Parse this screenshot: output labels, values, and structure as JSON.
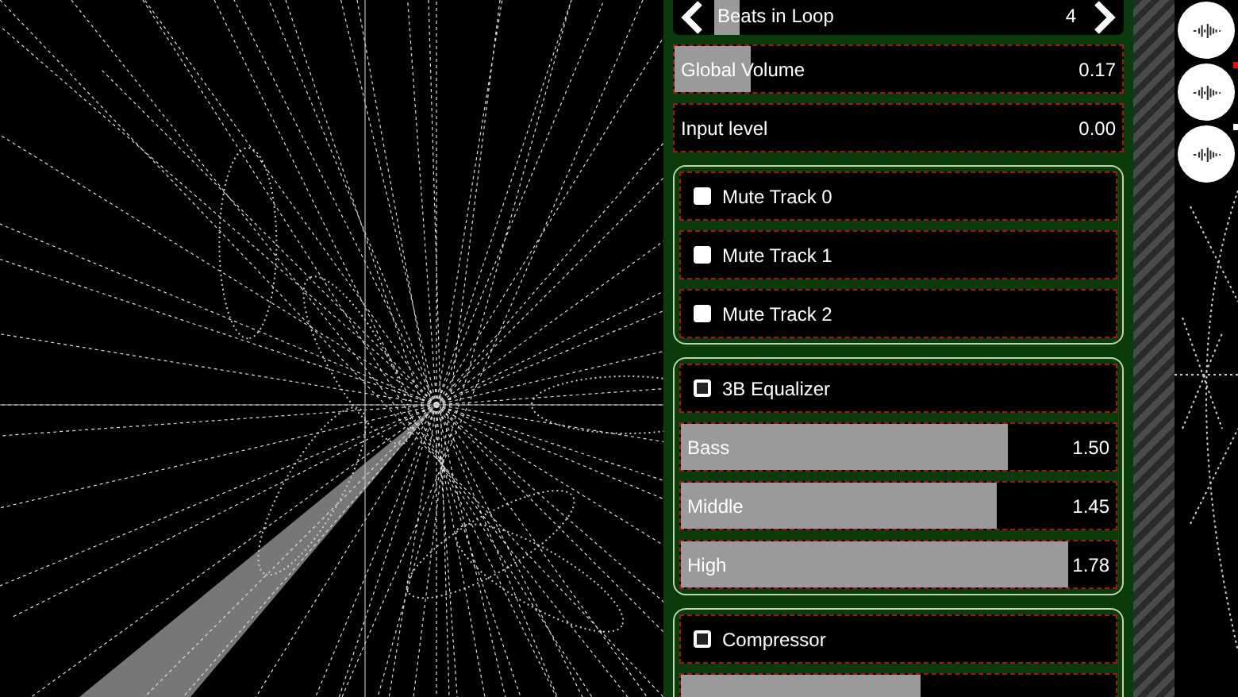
{
  "controls": [
    {
      "kind": "stepper",
      "label": "Beats in Loop",
      "value": "4",
      "level": 0.07
    },
    {
      "kind": "slider",
      "label": "Global Volume",
      "value": "0.17",
      "level": 0.17
    },
    {
      "kind": "slider",
      "label": "Input level",
      "value": "0.00",
      "level": 0
    },
    {
      "kind": "group",
      "items": [
        {
          "kind": "checkbox",
          "label": "Mute Track 0",
          "checked": false
        },
        {
          "kind": "checkbox",
          "label": "Mute Track 1",
          "checked": false
        },
        {
          "kind": "checkbox",
          "label": "Mute Track 2",
          "checked": false
        }
      ]
    },
    {
      "kind": "group",
      "items": [
        {
          "kind": "section_toggle",
          "label": "3B Equalizer",
          "checked": false
        },
        {
          "kind": "slider",
          "label": "Bass",
          "value": "1.50",
          "level": 0.75
        },
        {
          "kind": "slider",
          "label": "Middle",
          "value": "1.45",
          "level": 0.725
        },
        {
          "kind": "slider",
          "label": "High",
          "value": "1.78",
          "level": 0.89
        }
      ]
    },
    {
      "kind": "group",
      "items": [
        {
          "kind": "section_toggle",
          "label": "Compressor",
          "checked": false
        },
        {
          "kind": "slider",
          "level": 0.55
        }
      ]
    }
  ],
  "side_buttons": [
    {
      "kind": "waveform"
    },
    {
      "kind": "waveform",
      "color": "#ff0000"
    },
    {
      "kind": "waveform",
      "color": "#ffffff"
    }
  ]
}
